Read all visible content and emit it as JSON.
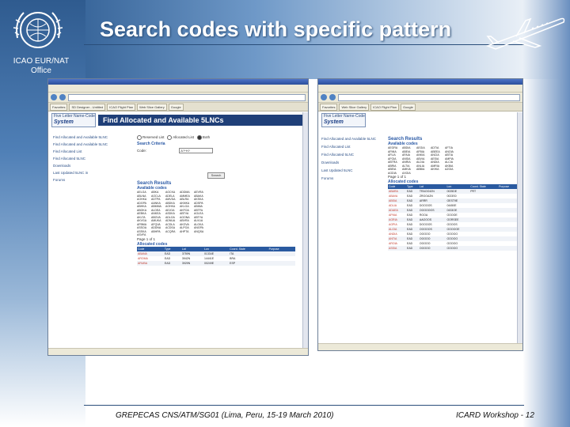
{
  "slide": {
    "title": "Search codes with specific pattern",
    "office_label": "ICAO EUR/NAT Office",
    "footer_left": "GREPECAS CNS/ATM/SG01 (Lima, Peru, 15-19 March 2010)",
    "footer_right": "ICARD Workshop - 12"
  },
  "colors": {
    "accent": "#2a5aa0",
    "title_rule": "#2a4e7a",
    "reserved_code": "#c0392b"
  },
  "icons": [
    "icao-logo-icon",
    "airplane-icon",
    "back-icon",
    "forward-icon"
  ],
  "window_left": {
    "tabs": [
      "Favorites",
      "SD Designer - Untitled",
      "ICAO Flight Plan",
      "Web Slice Gallery",
      "Google"
    ],
    "brand_line1": "Five Letter Name-Code",
    "brand_line2": "System",
    "banner": "Find Allocated and Available 5LNCs",
    "sidebar": [
      "Find Allocated and Available 5LNC",
      "Find Allocated and Available 5LNC",
      "Find Allocated List",
      "Find Allocated 5LNC",
      "Downloads",
      "Last Updated 5LNC in",
      "Forums"
    ],
    "search_criteria_label": "Search Criteria",
    "radio_options": [
      "Reserved List",
      "Allocated List",
      "Both"
    ],
    "code_label": "Code:",
    "code_value": "A?*H?",
    "search_button": "Search",
    "results_title": "Search Results",
    "available_title": "Available codes",
    "available_codes": [
      "AELGA",
      "ABKA",
      "AOCKA",
      "ADDMA",
      "AEVRA",
      "ABLNA",
      "AOCLA",
      "ADELA",
      "AMMEA",
      "ABAKA",
      "AOHKA",
      "ADTPA",
      "AMVDA",
      "ABLRA",
      "AKSKA",
      "ADGPA",
      "AANKA",
      "ABDKA",
      "AKMKA",
      "ADSPA",
      "ABHKA",
      "ABMMA",
      "AOHKA",
      "AKLGA",
      "ABIMA",
      "ABOKA",
      "ALDEA",
      "AEJOA",
      "AKFOA",
      "ABTFA",
      "AEBKA",
      "ANKEA",
      "ASDKA",
      "ABTVA",
      "AGLEA",
      "AKLTA",
      "ABOVA",
      "ADLOA",
      "AGONA",
      "ABTYA",
      "AKVGA",
      "AMUKA",
      "ADNUA",
      "ABVRA",
      "ALVUA",
      "AFBMA",
      "AFQVA",
      "ACDLA",
      "AKOVA",
      "ALGKA",
      "ASSOA",
      "ADDNA",
      "ACDSA",
      "ALPOA",
      "ANGPA",
      "ASSKA",
      "ABHPA",
      "ACQRA",
      "AHPTA",
      "ANQSA",
      "ASVFA"
    ],
    "page_info": "Page 1 of 1",
    "allocated_title": "Allocated codes",
    "allocated_headers": [
      "Code",
      "Type",
      "Lat",
      "Lon",
      "Coord. State",
      "Purpose"
    ],
    "allocated_rows": [
      [
        "ABANA",
        "EAD",
        "3759N",
        "01334E",
        "ITA",
        ""
      ],
      [
        "AROMA",
        "EAD",
        "3942N",
        "14441E",
        "BRA",
        ""
      ],
      [
        "ARUBA",
        "EAD",
        "3929N",
        "00249E",
        "ESP",
        ""
      ]
    ]
  },
  "window_right": {
    "tabs": [
      "Favorites",
      "Web Slice Gallery",
      "ICAO Flight Plan",
      "Google"
    ],
    "brand_line1": "Five Letter Name-Code",
    "brand_line2": "System",
    "sidebar": [
      "Find Allocated and Available 5LNC",
      "Find Allocated List",
      "Find Allocated 5LNC",
      "Downloads",
      "Last Updated 5LNC",
      "Forums"
    ],
    "results_title": "Search Results",
    "available_title": "Available codes",
    "available_codes": [
      "AEGRA",
      "ABDIA",
      "AEGIA",
      "ADTIA",
      "AFTIA",
      "AFMIA",
      "ABEIA",
      "AFBIA",
      "ABEEA",
      "ANOIA",
      "AFLIA",
      "AFAIA",
      "ANKIA",
      "ANCIA",
      "ABTIA",
      "AFGIA",
      "ANSIA",
      "ABVIA",
      "AESIA",
      "AMPIA",
      "ABTRA",
      "ANRIA",
      "ALDIA",
      "ANDIA",
      "ALCIA",
      "ABRIA",
      "ALTIA",
      "ANLIA",
      "AMRIA",
      "AKBIA",
      "ABEIA",
      "AMKIA",
      "ABBIA",
      "AKHIA",
      "AZGIA",
      "AGDIA",
      "AXGIA"
    ],
    "page_info": "Page 1 of 1",
    "allocated_title": "Allocated codes",
    "allocated_headers": [
      "Code",
      "Type",
      "Lat",
      "Lon",
      "Coord. State",
      "Purpose"
    ],
    "allocated_rows": [
      [
        "ABARA",
        "EAD",
        "TRAOO42N",
        "0025DE",
        "PRT",
        ""
      ],
      [
        "ABAVA",
        "EAD",
        "ZROOA2N",
        "0023S0",
        "",
        ""
      ],
      [
        "ABSIA",
        "EAD",
        "ARRR",
        "OEST9E",
        "",
        ""
      ],
      [
        "ADLIA",
        "EAD",
        "DOOOOS",
        "04450E",
        "",
        ""
      ],
      [
        "ADAEA",
        "EAD",
        "OOOOOOS",
        "0433OE",
        "",
        ""
      ],
      [
        "AFNIA",
        "EAD",
        "ROOA",
        "OOOOE",
        "",
        ""
      ],
      [
        "AGRIA",
        "EAD",
        "AAOOOS",
        "OORSEE",
        "",
        ""
      ],
      [
        "AGPIA",
        "EAD",
        "DOOOOS",
        "OOOOS",
        "",
        ""
      ],
      [
        "ALGIA",
        "EAD",
        "OOOOOS",
        "OOOOOE",
        "",
        ""
      ],
      [
        "ANDIA",
        "EAD",
        "OOOOO",
        "OOOOO",
        "",
        ""
      ],
      [
        "ANTIA",
        "EAD",
        "OOOOO",
        "OOOOO",
        "",
        ""
      ],
      [
        "AROIA",
        "EAD",
        "OOOOO",
        "OOOOO",
        "",
        ""
      ],
      [
        "ASSIA",
        "EAD",
        "OOOOO",
        "OOOOO",
        "",
        ""
      ]
    ]
  }
}
